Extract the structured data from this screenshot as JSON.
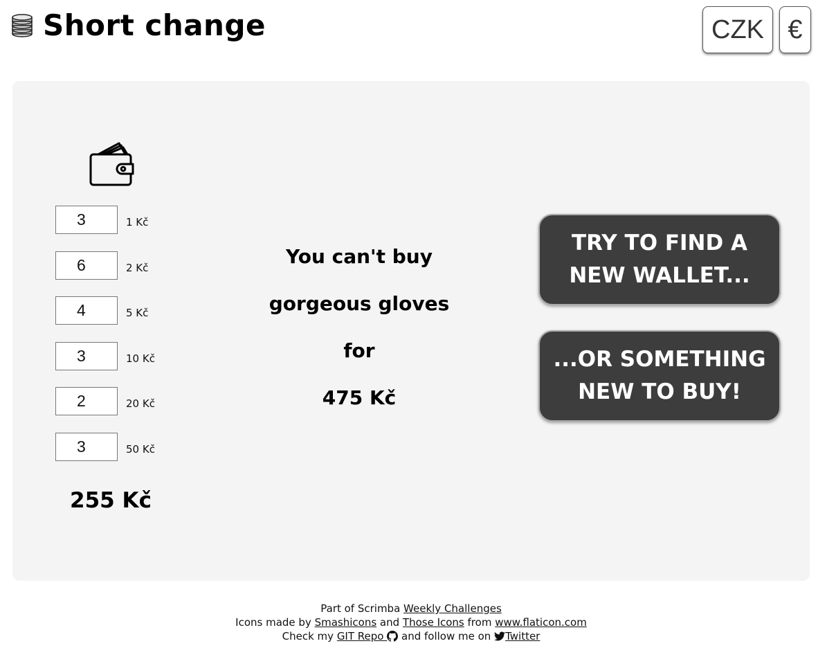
{
  "header": {
    "title": "Short change",
    "title_icon": "coins-icon",
    "currency_buttons": [
      {
        "label": "CZK"
      },
      {
        "label": "€"
      }
    ]
  },
  "wallet": {
    "icon": "wallet-icon",
    "coins": [
      {
        "count": "3",
        "denomination": "1 Kč"
      },
      {
        "count": "6",
        "denomination": "2 Kč"
      },
      {
        "count": "4",
        "denomination": "5 Kč"
      },
      {
        "count": "3",
        "denomination": "10 Kč"
      },
      {
        "count": "2",
        "denomination": "20 Kč"
      },
      {
        "count": "3",
        "denomination": "50 Kč"
      }
    ],
    "total": "255 Kč"
  },
  "message": {
    "line1": "You can't buy",
    "line2": "gorgeous gloves",
    "line3": "for",
    "line4": "475 Kč"
  },
  "actions": {
    "new_wallet": "Try to find a new wallet...",
    "new_item": "...or something new to buy!"
  },
  "footer": {
    "line1_prefix": "Part of Scrimba ",
    "line1_link": "Weekly Challenges",
    "line2_prefix": "Icons made by ",
    "line2_link1": "Smashicons",
    "line2_and": " and ",
    "line2_link2": "Those Icons",
    "line2_from": " from ",
    "line2_link3": "www.flaticon.com",
    "line3_prefix": "Check my ",
    "line3_link1": "GIT Repo",
    "line3_middle": " and follow me on ",
    "line3_link2": "Twitter"
  },
  "colors": {
    "panel_bg": "#f4f4f4",
    "button_bg": "#3d3d3d",
    "button_text": "#ffffff"
  }
}
